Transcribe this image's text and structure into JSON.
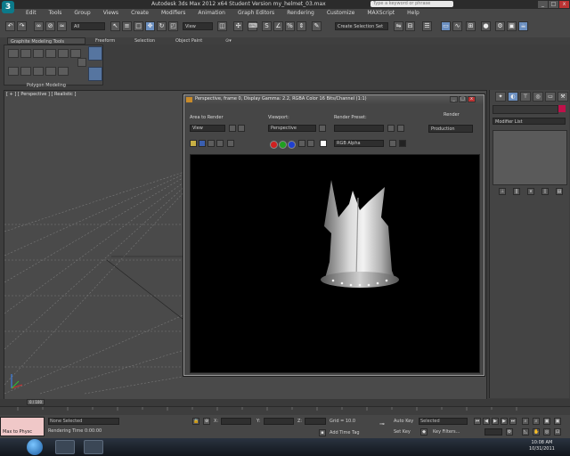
{
  "title": "Autodesk 3ds Max 2012 x64    Student Version    my_helmet_03.max",
  "search_placeholder": "Type a keyword or phrase",
  "window_controls": {
    "minimize": "_",
    "maximize": "□",
    "close": "x"
  },
  "menu": [
    "Edit",
    "Tools",
    "Group",
    "Views",
    "Create",
    "Modifiers",
    "Animation",
    "Graph Editors",
    "Rendering",
    "Customize",
    "MAXScript",
    "Help"
  ],
  "toolbar": {
    "selection_filter": "All",
    "view_dropdown": "View",
    "named_selection": "Create Selection Set"
  },
  "ribbon": {
    "tabs": [
      "Graphite Modeling Tools",
      "Freeform",
      "Selection",
      "Object Paint"
    ],
    "panel_label": "Polygon Modeling"
  },
  "viewport": {
    "label": "[ + ] [ Perspective ] [ Realistic ]"
  },
  "command_panel": {
    "modifier_list": "Modifier List"
  },
  "render_window": {
    "title": "Perspective, frame 0, Display Gamma: 2.2, RGBA Color 16 Bits/Channel (1:1)",
    "area_label": "Area to Render",
    "area_value": "View",
    "viewport_label": "Viewport:",
    "viewport_value": "Perspective",
    "preset_label": "Render Preset:",
    "preset_value": "",
    "render_label": "Render",
    "render_value": "Production",
    "channel_value": "RGB Alpha"
  },
  "timeline": {
    "frame_display": "0 / 100",
    "ticks": [
      "0",
      "5",
      "10",
      "15",
      "20",
      "25",
      "30",
      "35",
      "40",
      "45",
      "50",
      "55",
      "60",
      "65",
      "70",
      "75",
      "80",
      "85",
      "90",
      "95",
      "100"
    ]
  },
  "status": {
    "maxscript": "Max to Physc",
    "selection": "None Selected",
    "rendering_time": "Rendering Time 0:00:00",
    "x_label": "X:",
    "y_label": "Y:",
    "z_label": "Z:",
    "grid": "Grid = 10.0",
    "add_time_tag": "Add Time Tag",
    "auto_key": "Auto Key",
    "auto_key_value": "Selected",
    "set_key": "Set Key",
    "key_filters": "Key Filters..."
  },
  "taskbar": {
    "time": "10:08 AM",
    "date": "10/31/2011"
  },
  "colors": {
    "swatch": "#c0104a",
    "maxscript_bg": "#f0c8c8"
  }
}
